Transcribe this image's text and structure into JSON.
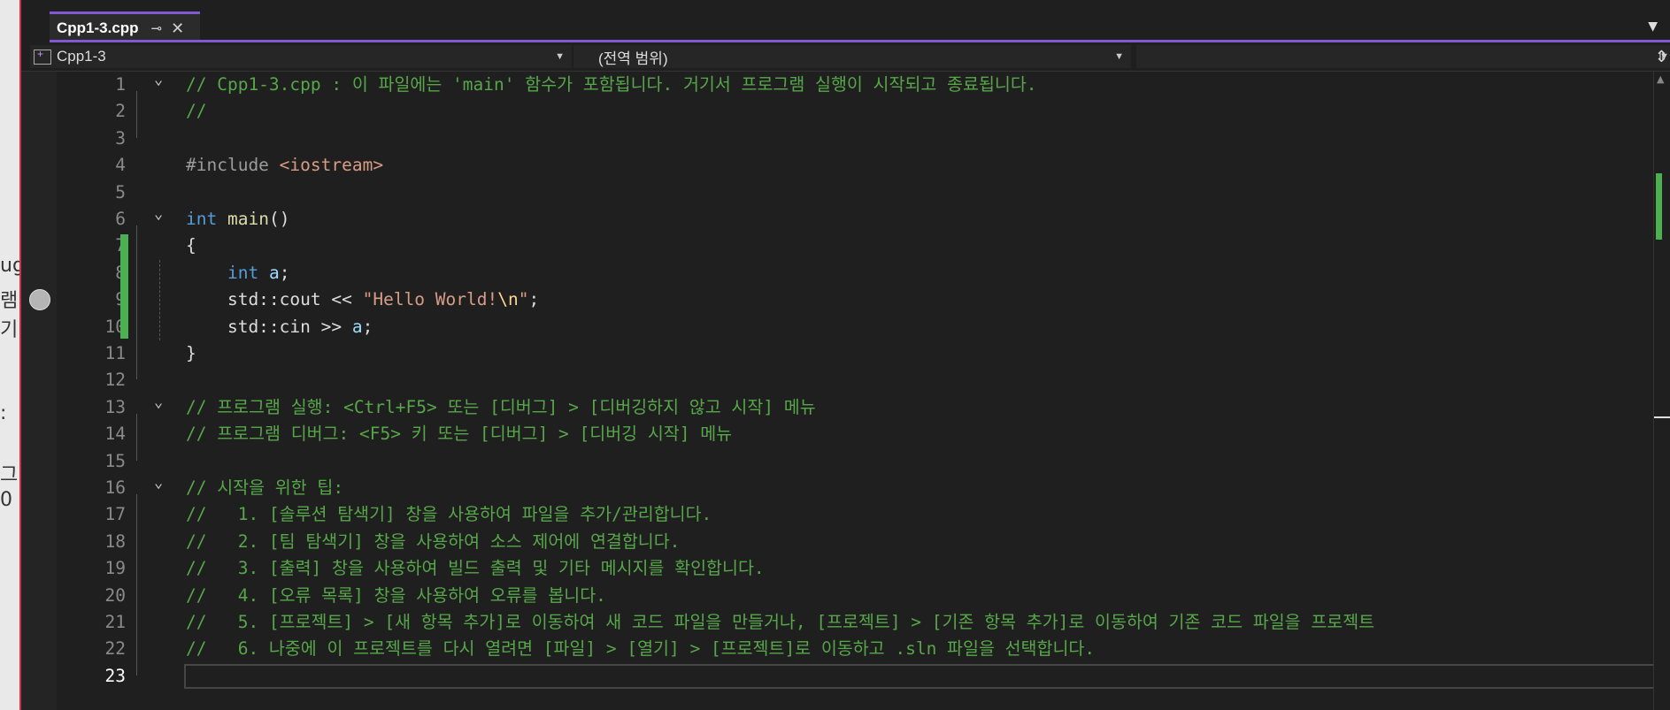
{
  "left_strip": {
    "chars": [
      "ug",
      "램",
      "기",
      ":",
      "그",
      "0"
    ]
  },
  "tab": {
    "title": "Cpp1-3.cpp",
    "pin": "⊸",
    "close": "✕"
  },
  "nav": {
    "project": "Cpp1-3",
    "scope": "(전역 범위)",
    "member": ""
  },
  "lines": [
    {
      "n": "1",
      "fold": "v",
      "t": [
        [
          "c-com",
          "// Cpp1-3.cpp : 이 파일에는 'main' 함수가 포함됩니다. 거기서 프로그램 실행이 시작되고 종료됩니다."
        ]
      ]
    },
    {
      "n": "2",
      "fold": "",
      "t": [
        [
          "c-com",
          "//"
        ]
      ]
    },
    {
      "n": "3",
      "fold": "",
      "t": []
    },
    {
      "n": "4",
      "fold": "",
      "t": [
        [
          "c-pp",
          "#include "
        ],
        [
          "c-inc",
          "<iostream>"
        ]
      ]
    },
    {
      "n": "5",
      "fold": "",
      "t": []
    },
    {
      "n": "6",
      "fold": "v",
      "t": [
        [
          "c-kw",
          "int"
        ],
        [
          "c-pl",
          " "
        ],
        [
          "c-fn",
          "main"
        ],
        [
          "c-pl",
          "()"
        ]
      ]
    },
    {
      "n": "7",
      "fold": "",
      "t": [
        [
          "c-pl",
          "{"
        ]
      ]
    },
    {
      "n": "8",
      "fold": "",
      "t": [
        [
          "c-pl",
          "    "
        ],
        [
          "c-kw",
          "int"
        ],
        [
          "c-pl",
          " "
        ],
        [
          "c-var",
          "a"
        ],
        [
          "c-pl",
          ";"
        ]
      ]
    },
    {
      "n": "9",
      "fold": "",
      "t": [
        [
          "c-pl",
          "    std::"
        ],
        [
          "c-pl",
          "cout << "
        ],
        [
          "c-str",
          "\"Hello World!"
        ],
        [
          "c-esc",
          "\\n"
        ],
        [
          "c-str",
          "\""
        ],
        [
          "c-pl",
          ";"
        ]
      ]
    },
    {
      "n": "10",
      "fold": "",
      "t": [
        [
          "c-pl",
          "    std::"
        ],
        [
          "c-pl",
          "cin >> "
        ],
        [
          "c-var",
          "a"
        ],
        [
          "c-pl",
          ";"
        ]
      ]
    },
    {
      "n": "11",
      "fold": "",
      "t": [
        [
          "c-pl",
          "}"
        ]
      ]
    },
    {
      "n": "12",
      "fold": "",
      "t": []
    },
    {
      "n": "13",
      "fold": "v",
      "t": [
        [
          "c-com",
          "// 프로그램 실행: <Ctrl+F5> 또는 [디버그] > [디버깅하지 않고 시작] 메뉴"
        ]
      ]
    },
    {
      "n": "14",
      "fold": "",
      "t": [
        [
          "c-com",
          "// 프로그램 디버그: <F5> 키 또는 [디버그] > [디버깅 시작] 메뉴"
        ]
      ]
    },
    {
      "n": "15",
      "fold": "",
      "t": []
    },
    {
      "n": "16",
      "fold": "v",
      "t": [
        [
          "c-com",
          "// 시작을 위한 팁:"
        ]
      ]
    },
    {
      "n": "17",
      "fold": "",
      "t": [
        [
          "c-com",
          "//   1. [솔루션 탐색기] 창을 사용하여 파일을 추가/관리합니다."
        ]
      ]
    },
    {
      "n": "18",
      "fold": "",
      "t": [
        [
          "c-com",
          "//   2. [팀 탐색기] 창을 사용하여 소스 제어에 연결합니다."
        ]
      ]
    },
    {
      "n": "19",
      "fold": "",
      "t": [
        [
          "c-com",
          "//   3. [출력] 창을 사용하여 빌드 출력 및 기타 메시지를 확인합니다."
        ]
      ]
    },
    {
      "n": "20",
      "fold": "",
      "t": [
        [
          "c-com",
          "//   4. [오류 목록] 창을 사용하여 오류를 봅니다."
        ]
      ]
    },
    {
      "n": "21",
      "fold": "",
      "t": [
        [
          "c-com",
          "//   5. [프로젝트] > [새 항목 추가]로 이동하여 새 코드 파일을 만들거나, [프로젝트] > [기존 항목 추가]로 이동하여 기존 코드 파일을 프로젝트"
        ]
      ]
    },
    {
      "n": "22",
      "fold": "",
      "t": [
        [
          "c-com",
          "//   6. 나중에 이 프로젝트를 다시 열려면 [파일] > [열기] > [프로젝트]로 이동하고 .sln 파일을 선택합니다."
        ]
      ]
    },
    {
      "n": "23",
      "fold": "",
      "t": []
    }
  ],
  "current_line": "23",
  "colors": {
    "accent": "#7f5ad1",
    "change_bar": "#4caf50",
    "comment": "#57a64a",
    "keyword": "#569cd6"
  }
}
